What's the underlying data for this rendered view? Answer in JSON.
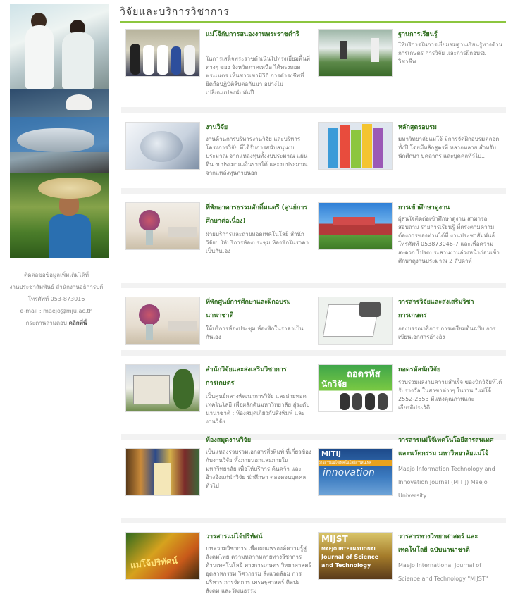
{
  "header": {
    "title": "วิจัยและบริการวิชาการ"
  },
  "sidebar": {
    "contact_line1": "ติดต่อขอข้อมูลเพิ่มเติมได้ที่",
    "contact_line2": "งานประชาสัมพันธ์ สำนักงานอธิการบดี",
    "contact_line3": "โทรศัพท์ 053-873016",
    "contact_line4": "e-mail : maejo@mju.ac.th",
    "contact_line5": "กระดานถามตอบ",
    "contact_link": "คลิกที่นี่"
  },
  "items": [
    {
      "title": "แม่โจ้กับการสนองงานพระราชดำริ",
      "desc": "ในการเสด็จพระราชดำเนินไปทรงเยี่ยมพื้นที่ต่างๆ ของ จังหวัดภาคเหนือ ได้ทรงทอดพระเนตร เห็นชาวเขามีวิถี การดำรงชีพที่ยึดถือปฏิบัติสืบต่อกันมา อย่างไม่เปลี่ยนแปลงนับพันปี..."
    },
    {
      "title": "ฐานการเรียนรู้",
      "desc": "ให้บริการในการเยี่ยมชมฐานเรียนรู้ทางด้านการเกษตร การวิจัย และการฝึกอบรมวิชาชีพ.."
    },
    {
      "title": "งานวิจัย",
      "desc": "งานด้านการบริหารงานวิจัย และบริหารโครงการวิจัย ที่ได้รับการสนับสนุนงบประมาณ จากแหล่งทุนทั้งงบประมาณ แผ่นดิน งบประมาณเงินรายได้ และงบประมาณจากแหล่งทุนภายนอก"
    },
    {
      "title": "หลักสูตรอบรม",
      "desc": "มหาวิทยาลัยแม่โจ้ มีการจัดฝึกอบรมตลอดทั้งปี โดยมีหลักสูตรที่ หลากหลาย สำหรับนักศึกษา บุคลากร และบุคคลทั่วไป.."
    },
    {
      "title": "ที่พักอาคารธรรมศักดิ์มนตรี (ศูนย์การศึกษาต่อเนื่อง)",
      "desc": "ฝ่ายบริการและถ่ายทอดเทคโนโลยี สำนักวิจัยฯ ให้บริการห้องประชุม ห้องพักในราคาเป็นกันเอง"
    },
    {
      "title": "การเข้าศึกษาดูงาน",
      "desc": "ผู้สนใจติดต่อเข้าศึกษาดูงาน สามารถสอบถาม รายการเรียนรู้ ที่ตรงตามความต้องการของท่านได้ที่ งานประชาสัมพันธ์ โทรศัพท์ 053873046-7 และเพื่อความสะดวก โปรดประสานงานล่วงหน้าก่อนเข้าศึกษาดูงานประมาณ 2 สัปดาห์"
    },
    {
      "title": "ที่พักศูนย์การศึกษาและฝึกอบรมนานาชาติ",
      "desc": "ให้บริการห้องประชุม ห้องพักในราคาเป็นกันเอง"
    },
    {
      "title": "วารสารวิจัยและส่งเสริมวิชา การเกษตร",
      "desc": "กองบรรณาธิการ การเตรียมต้นฉบับ การเขียนเอกสารอ้างอิง"
    },
    {
      "title": "สำนักวิจัยและส่งเสริมวิชาการการเกษตร",
      "desc": "เป็นศูนย์กลางพัฒนาการวิจัย และถ่ายทอดเทคโนโลยี เพื่อผลักดันมหาวิทยาลัย สู่ระดับนานาชาติ : ห้องสมุดเกี่ยวกับสิ่งพิมพ์ และงานวิจัย"
    },
    {
      "title": "ถอดรหัสนักวิจัย",
      "desc": "รวบรวมผลงานความสำเร็จ ของนักวิจัยที่ได้รับรางวัล ในสาขาต่างๆ ในงาน \"แม่โจ้ 2552-2553 มีแห่งคุณภาพและเกียรติประวัติ"
    },
    {
      "title": "ห้องสมุดงานวิจัย",
      "desc": "เป็นแหล่งรวบรวมเอกสารสิ่งพิมพ์ ที่เกี่ยวข้องกับงานวิจัย ทั้งภายนอกและภายในมหาวิทยาลัย เพื่อให้บริการ ค้นคว้า และอ้างอิงแก่นักวิจัย นักศึกษา ตลอดจนบุคคลทั่วไป"
    },
    {
      "title": "วารสารแม่โจ้เทคโนโลยีสารสนเทศและนวัตกรรม มหาวิทยาลัยแม่โจ้",
      "desc": "Maejo Information Technology and Innovation Journal (MITIJ) Maejo University"
    },
    {
      "title": "วารสารแม่โจ้ปริทัศน์",
      "desc": "บทความวิชาการ เพื่อเผยแพร่องค์ความรู้สู่สังคมไทย ความหลากหลายทางวิชาการด้านเทคโนโลยี ทางการเกษตร วิทยาศาสตร์ อุตสาหกรรม วิศวกรรม สิ่งแวดล้อม การบริหาร การจัดการ เศรษฐศาสตร์ ศิลปะ สังคม และวัฒนธรรม"
    },
    {
      "title": "วารสารทางวิทยาศาสตร์ และเทคโนโลยี ฉบับนานาชาติ",
      "desc": "Maejo International Journal of Science and Technology \"MIJST\""
    }
  ],
  "thumb_text": {
    "decode_title": "ถอดรหัส",
    "decode_sub": "นักวิจัย",
    "mitij_label": "MITIJ",
    "mitij_banner": "วารสารแม่โจ้เทคโนโลยีสารสนเทศ",
    "mitij_word": "innovation",
    "mijst_label": "MIJST",
    "mijst_line1": "MAEJO INTERNATIONAL",
    "mijst_line2": "Journal of Science",
    "mijst_line3": "and Technology",
    "review_label": "แม่โจ้ปริทัศน์"
  }
}
